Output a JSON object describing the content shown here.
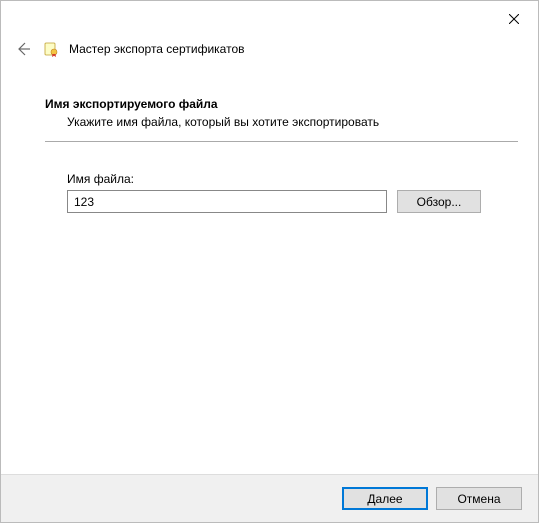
{
  "window": {
    "title": "Мастер экспорта сертификатов"
  },
  "section": {
    "heading": "Имя экспортируемого файла",
    "description": "Укажите имя файла, который вы хотите экспортировать"
  },
  "field": {
    "label": "Имя файла:",
    "value": "123",
    "browse_label": "Обзор..."
  },
  "footer": {
    "next_label": "Далее",
    "cancel_label": "Отмена"
  }
}
